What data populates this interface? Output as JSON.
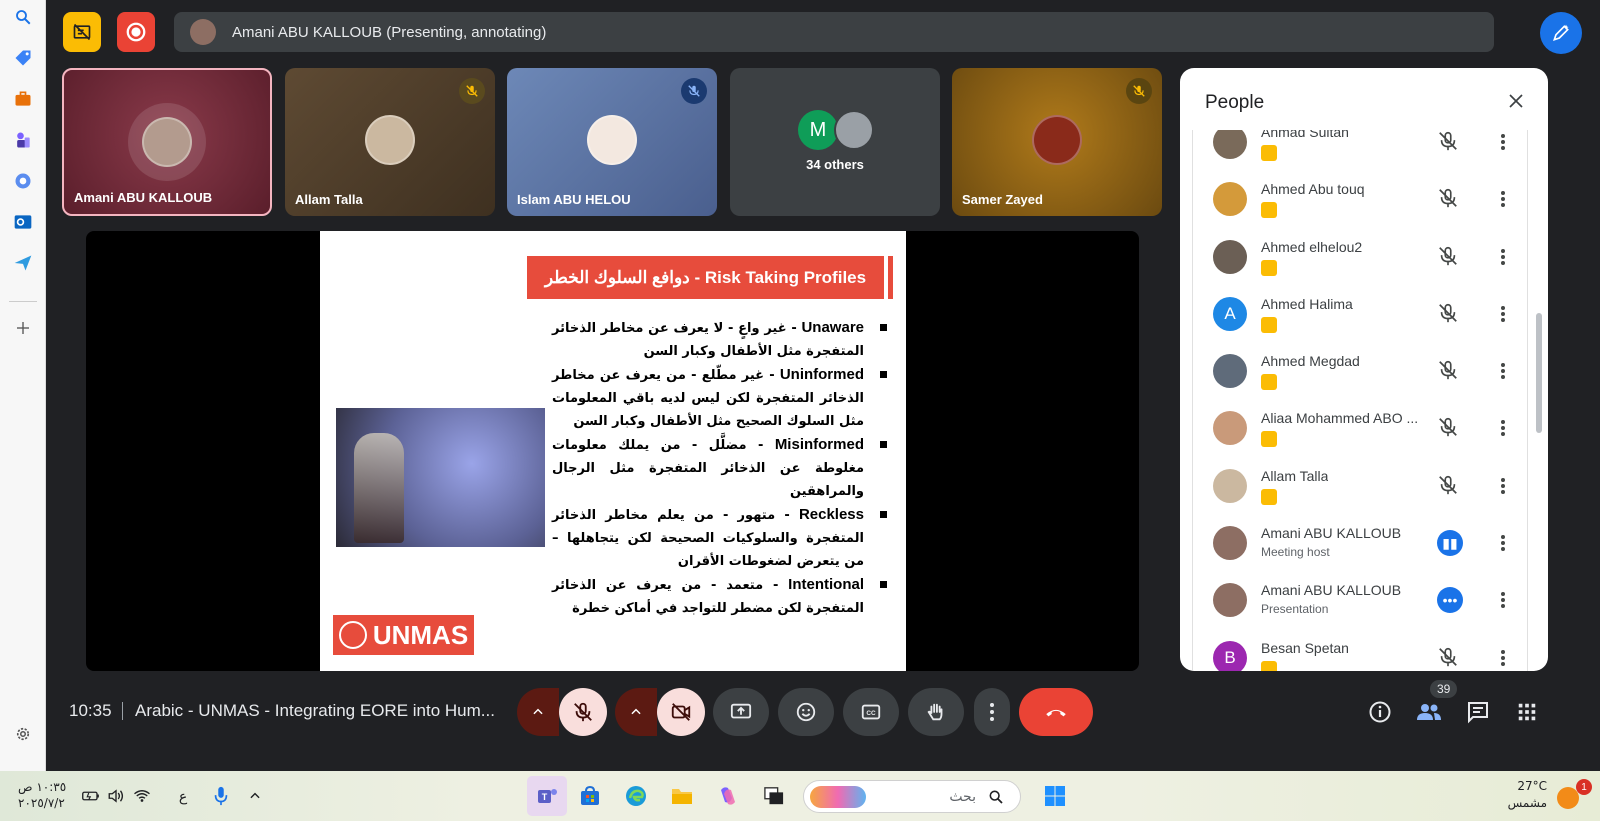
{
  "edge_sidebar": {
    "items": [
      "search-icon",
      "tag-icon",
      "briefcase-icon",
      "chess-icon",
      "copilot-icon",
      "outlook-icon",
      "send-icon",
      "add-icon",
      "settings-icon"
    ]
  },
  "top_bar": {
    "presenting_text": "Amani ABU KALLOUB (Presenting, annotating)"
  },
  "tiles": [
    {
      "name": "Amani ABU KALLOUB"
    },
    {
      "name": "Allam Talla"
    },
    {
      "name": "Islam ABU HELOU"
    },
    {
      "name": "34 others",
      "initial": "M"
    },
    {
      "name": "Samer Zayed"
    }
  ],
  "slide": {
    "title": "دوافع السلوك الخطر - Risk Taking Profiles",
    "bullets": [
      {
        "term": "Unaware",
        "text": " - غير واعٍ - لا يعرف عن مخاطر الذخائر المتفجرة مثل الأطفال وكبار السن"
      },
      {
        "term": "Uninformed",
        "text": " - غير مطّلع - من يعرف عن مخاطر الذخائر المتفجرة لكن ليس لديه باقي المعلومات مثل السلوك الصحيح مثل الأطفال وكبار السن"
      },
      {
        "term": "Misinformed",
        "text": " - مضلَّل - من يملك معلومات مغلوطة عن الذخائر المتفجرة مثل الرجال والمراهقين"
      },
      {
        "term": "Reckless",
        "text": " - متهور - من يعلم مخاطر الذخائر المتفجرة والسلوكيات الصحيحة لكن يتجاهلها – من يتعرض لضغوطات الأقران"
      },
      {
        "term": "Intentional",
        "text": " - متعمد - من يعرف عن الذخائر المتفجرة لكن مضطر للتواجد في أماكن خطرة"
      }
    ],
    "logo_text": "UNMAS"
  },
  "people_panel": {
    "title": "People",
    "participants": [
      {
        "name": "Ahmad Sultan",
        "avatar": "photo",
        "color": "#7a6a5a"
      },
      {
        "name": "Ahmed Abu touq",
        "avatar": "photo",
        "color": "#d49a3a"
      },
      {
        "name": "Ahmed elhelou2",
        "avatar": "photo",
        "color": "#6b5f55"
      },
      {
        "name": "Ahmed Halima",
        "avatar": "initial",
        "initial": "A",
        "color": "#1e88e5"
      },
      {
        "name": "Ahmed Megdad",
        "avatar": "photo",
        "color": "#5f6b7a"
      },
      {
        "name": "Aliaa Mohammed ABO ...",
        "avatar": "photo",
        "color": "#c99a7a"
      },
      {
        "name": "Allam Talla",
        "avatar": "photo",
        "color": "#cbb8a0"
      },
      {
        "name": "Amani ABU KALLOUB",
        "sub": "Meeting host",
        "avatar": "photo",
        "color": "#8d6e63",
        "status": "speaking"
      },
      {
        "name": "Amani ABU KALLOUB",
        "sub": "Presentation",
        "avatar": "photo",
        "color": "#8d6e63",
        "status": "presenting"
      },
      {
        "name": "Besan Spetan",
        "avatar": "initial",
        "initial": "B",
        "color": "#9c27b0"
      }
    ]
  },
  "bottom_bar": {
    "time": "10:35",
    "meeting_title": "Arabic - UNMAS - Integrating EORE into Hum...",
    "people_count": "39"
  },
  "taskbar": {
    "time": "١٠:٣٥ ص",
    "date": "٢٠٢٥/٧/٢",
    "lang": "ع",
    "search_placeholder": "بحث",
    "temperature": "27°C",
    "weather": "مشمس",
    "notification_count": "1"
  },
  "colors": {
    "meet_bg": "#202124",
    "accent_blue": "#1a73e8",
    "leave_red": "#ea4335",
    "slide_red": "#e74c3c",
    "record_yellow": "#fbbc04"
  }
}
